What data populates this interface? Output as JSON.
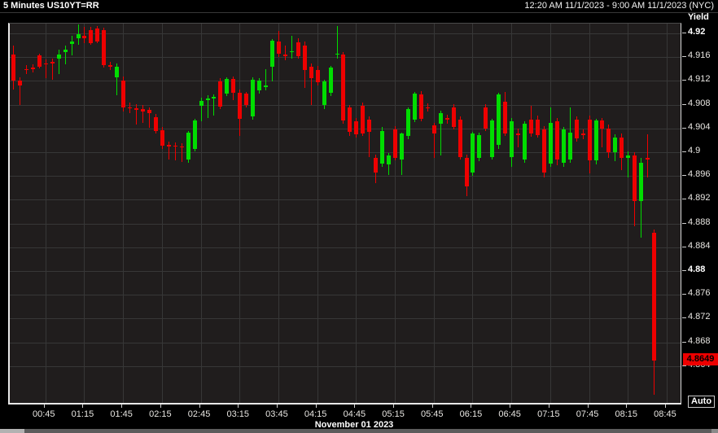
{
  "header": {
    "title": "5 Minutes US10YT=RR",
    "time_range": "12:20 AM 11/1/2023 - 9:00 AM 11/1/2023 (NYC)"
  },
  "y_axis": {
    "title": "Yield",
    "ticks": [
      {
        "label": "4.92",
        "value": 4.92,
        "bold": true
      },
      {
        "label": "4.916",
        "value": 4.916,
        "bold": false
      },
      {
        "label": "4.912",
        "value": 4.912,
        "bold": false
      },
      {
        "label": "4.908",
        "value": 4.908,
        "bold": false
      },
      {
        "label": "4.904",
        "value": 4.904,
        "bold": false
      },
      {
        "label": "4.9",
        "value": 4.9,
        "bold": false
      },
      {
        "label": "4.896",
        "value": 4.896,
        "bold": false
      },
      {
        "label": "4.892",
        "value": 4.892,
        "bold": false
      },
      {
        "label": "4.888",
        "value": 4.888,
        "bold": false
      },
      {
        "label": "4.884",
        "value": 4.884,
        "bold": false
      },
      {
        "label": "4.88",
        "value": 4.88,
        "bold": true
      },
      {
        "label": "4.876",
        "value": 4.876,
        "bold": false
      },
      {
        "label": "4.872",
        "value": 4.872,
        "bold": false
      },
      {
        "label": "4.868",
        "value": 4.868,
        "bold": false
      },
      {
        "label": "4.864",
        "value": 4.864,
        "bold": false
      }
    ],
    "last_price": "4.8649",
    "auto_button": "Auto"
  },
  "x_axis": {
    "ticks": [
      {
        "label": "00:45",
        "index": 5
      },
      {
        "label": "01:15",
        "index": 11
      },
      {
        "label": "01:45",
        "index": 17
      },
      {
        "label": "02:15",
        "index": 23
      },
      {
        "label": "02:45",
        "index": 29
      },
      {
        "label": "03:15",
        "index": 35
      },
      {
        "label": "03:45",
        "index": 41
      },
      {
        "label": "04:15",
        "index": 47
      },
      {
        "label": "04:45",
        "index": 53
      },
      {
        "label": "05:15",
        "index": 59
      },
      {
        "label": "05:45",
        "index": 65
      },
      {
        "label": "06:15",
        "index": 71
      },
      {
        "label": "06:45",
        "index": 77
      },
      {
        "label": "07:15",
        "index": 83
      },
      {
        "label": "07:45",
        "index": 89
      },
      {
        "label": "08:15",
        "index": 95
      },
      {
        "label": "08:45",
        "index": 101
      }
    ],
    "date_label": "November 01 2023"
  },
  "chart_data": {
    "type": "candlestick",
    "instrument": "US10YT=RR",
    "interval": "5 Minutes",
    "title": "5 Minutes US10YT=RR",
    "ylabel": "Yield",
    "time_range": "12:20 AM 11/1/2023 - 9:00 AM 11/1/2023 (NYC)",
    "last_price": 4.8649,
    "up_color": "#00dd00",
    "down_color": "#ee0000",
    "ylim": [
      4.857,
      4.9215
    ],
    "grid": true,
    "legend_position": "none",
    "candles": [
      [
        "00:20",
        4.9165,
        4.918,
        4.9105,
        4.912
      ],
      [
        "00:25",
        4.912,
        4.9126,
        4.908,
        4.9112
      ],
      [
        "00:30",
        4.914,
        4.9146,
        4.9132,
        4.914
      ],
      [
        "00:35",
        4.9142,
        4.9148,
        4.9134,
        4.9142
      ],
      [
        "00:40",
        4.9163,
        4.9166,
        4.9141,
        4.9144
      ],
      [
        "00:45",
        4.915,
        4.9156,
        4.9124,
        4.915
      ],
      [
        "00:50",
        4.9152,
        4.9158,
        4.9122,
        4.9152
      ],
      [
        "00:55",
        4.9158,
        4.9172,
        4.9132,
        4.9164
      ],
      [
        "01:00",
        4.9168,
        4.918,
        4.9148,
        4.9172
      ],
      [
        "01:05",
        4.9182,
        4.9196,
        4.9163,
        4.9186
      ],
      [
        "01:10",
        4.9192,
        4.9215,
        4.9181,
        4.9198
      ],
      [
        "01:15",
        4.9196,
        4.9211,
        4.9184,
        4.9192
      ],
      [
        "01:20",
        4.9206,
        4.9211,
        4.9181,
        4.9184
      ],
      [
        "01:25",
        4.9208,
        4.9213,
        4.9183,
        4.9186
      ],
      [
        "01:30",
        4.9205,
        4.9209,
        4.9142,
        4.9146
      ],
      [
        "01:35",
        4.9146,
        4.9152,
        4.9138,
        4.9145
      ],
      [
        "01:40",
        4.9126,
        4.9149,
        4.9096,
        4.9144
      ],
      [
        "01:45",
        4.9121,
        4.9127,
        4.9068,
        4.9076
      ],
      [
        "01:50",
        4.9076,
        4.9083,
        4.9066,
        4.9075
      ],
      [
        "01:55",
        4.9074,
        4.9081,
        4.9046,
        4.9071
      ],
      [
        "02:00",
        4.9073,
        4.9079,
        4.9049,
        4.9069
      ],
      [
        "02:05",
        4.9071,
        4.9076,
        4.9041,
        4.9066
      ],
      [
        "02:10",
        4.9059,
        4.9064,
        4.9031,
        4.9036
      ],
      [
        "02:15",
        4.9037,
        4.9042,
        4.9006,
        4.9011
      ],
      [
        "02:20",
        4.9012,
        4.9018,
        4.8988,
        4.901
      ],
      [
        "02:25",
        4.9011,
        4.9016,
        4.8986,
        4.9009
      ],
      [
        "02:30",
        4.901,
        4.9015,
        4.8984,
        4.9008
      ],
      [
        "02:35",
        4.8987,
        4.9036,
        4.8982,
        4.9033
      ],
      [
        "02:40",
        4.9006,
        4.9056,
        4.9002,
        4.9053
      ],
      [
        "02:45",
        4.9078,
        4.9092,
        4.9052,
        4.9086
      ],
      [
        "02:50",
        4.9088,
        4.9096,
        4.9058,
        4.909
      ],
      [
        "02:55",
        4.9091,
        4.9097,
        4.9061,
        4.9093
      ],
      [
        "03:00",
        4.9119,
        4.9124,
        4.9072,
        4.9077
      ],
      [
        "03:05",
        4.9099,
        4.9126,
        4.9094,
        4.9123
      ],
      [
        "03:10",
        4.9123,
        4.9128,
        4.9088,
        4.91
      ],
      [
        "03:15",
        4.91,
        4.9105,
        4.9028,
        4.9056
      ],
      [
        "03:20",
        4.9098,
        4.9102,
        4.9075,
        4.908
      ],
      [
        "03:25",
        4.906,
        4.9126,
        4.9055,
        4.9122
      ],
      [
        "03:30",
        4.9104,
        4.9124,
        4.9098,
        4.912
      ],
      [
        "03:35",
        4.911,
        4.914,
        4.9104,
        4.9112
      ],
      [
        "03:40",
        4.9144,
        4.919,
        4.9119,
        4.9187
      ],
      [
        "03:45",
        4.9186,
        4.9204,
        4.916,
        4.9166
      ],
      [
        "03:50",
        4.9164,
        4.918,
        4.9155,
        4.9164
      ],
      [
        "03:55",
        4.9168,
        4.9196,
        4.9158,
        4.917
      ],
      [
        "04:00",
        4.9185,
        4.9192,
        4.9158,
        4.9162
      ],
      [
        "04:05",
        4.918,
        4.9186,
        4.9108,
        4.9139
      ],
      [
        "04:10",
        4.9144,
        4.915,
        4.908,
        4.9124
      ],
      [
        "04:15",
        4.9138,
        4.9145,
        4.9112,
        4.9118
      ],
      [
        "04:20",
        4.908,
        4.9122,
        4.9072,
        4.9119
      ],
      [
        "04:25",
        4.91,
        4.9145,
        4.9094,
        4.9142
      ],
      [
        "04:30",
        4.9165,
        4.9212,
        4.9158,
        4.9166
      ],
      [
        "04:35",
        4.9164,
        4.9169,
        4.9048,
        4.9053
      ],
      [
        "04:40",
        4.9075,
        4.908,
        4.9028,
        4.9034
      ],
      [
        "04:45",
        4.9052,
        4.9058,
        4.9024,
        4.903
      ],
      [
        "04:50",
        4.9078,
        4.9083,
        4.9027,
        4.9031
      ],
      [
        "04:55",
        4.9055,
        4.906,
        4.8992,
        4.9034
      ],
      [
        "05:00",
        4.899,
        4.8996,
        4.8948,
        4.8966
      ],
      [
        "05:05",
        4.8981,
        4.9042,
        4.8975,
        4.9036
      ],
      [
        "05:10",
        4.898,
        4.8998,
        4.8962,
        4.8995
      ],
      [
        "05:15",
        4.9038,
        4.9044,
        4.8986,
        4.899
      ],
      [
        "05:20",
        4.8987,
        4.9033,
        4.8961,
        4.9031
      ],
      [
        "05:25",
        4.9028,
        4.9075,
        4.9022,
        4.9073
      ],
      [
        "05:30",
        4.9055,
        4.9101,
        4.905,
        4.9099
      ],
      [
        "05:35",
        4.9097,
        4.9103,
        4.9052,
        4.9056
      ],
      [
        "05:40",
        4.9076,
        4.9082,
        4.9068,
        4.9076
      ],
      [
        "05:45",
        4.9045,
        4.905,
        4.899,
        4.9032
      ],
      [
        "05:50",
        4.9048,
        4.907,
        4.8994,
        4.9066
      ],
      [
        "05:55",
        4.9057,
        4.9063,
        4.9048,
        4.9057
      ],
      [
        "06:00",
        4.9076,
        4.9081,
        4.9038,
        4.9042
      ],
      [
        "06:05",
        4.9055,
        4.906,
        4.8988,
        4.8992
      ],
      [
        "06:10",
        4.899,
        4.8996,
        4.8926,
        4.8942
      ],
      [
        "06:15",
        4.8966,
        4.9034,
        4.896,
        4.9031
      ],
      [
        "06:20",
        4.899,
        4.9033,
        4.8985,
        4.9029
      ],
      [
        "06:25",
        4.9076,
        4.9081,
        4.9036,
        4.904
      ],
      [
        "06:30",
        4.8992,
        4.9056,
        4.8988,
        4.9053
      ],
      [
        "06:35",
        4.9012,
        4.91,
        4.9006,
        4.9097
      ],
      [
        "06:40",
        4.9085,
        4.9102,
        4.9028,
        4.9032
      ],
      [
        "06:45",
        4.8992,
        4.9058,
        4.8975,
        4.9052
      ],
      [
        "06:50",
        4.9031,
        4.904,
        4.9008,
        4.9031
      ],
      [
        "06:55",
        4.8988,
        4.9052,
        4.8982,
        4.9048
      ],
      [
        "07:00",
        4.9055,
        4.9078,
        4.9026,
        4.9031
      ],
      [
        "07:05",
        4.9055,
        4.9061,
        4.9024,
        4.9029
      ],
      [
        "07:10",
        4.9038,
        4.9044,
        4.8958,
        4.8966
      ],
      [
        "07:15",
        4.8981,
        4.9075,
        4.8976,
        4.905
      ],
      [
        "07:20",
        4.9052,
        4.9058,
        4.8978,
        4.8988
      ],
      [
        "07:25",
        4.8982,
        4.9042,
        4.8976,
        4.9038
      ],
      [
        "07:30",
        4.8988,
        4.9075,
        4.8982,
        4.9033
      ],
      [
        "07:35",
        4.9055,
        4.906,
        4.9018,
        4.9023
      ],
      [
        "07:40",
        4.9031,
        4.9038,
        4.9022,
        4.9031
      ],
      [
        "07:45",
        4.9055,
        4.9061,
        4.8964,
        4.8986
      ],
      [
        "07:50",
        4.8986,
        4.9056,
        4.898,
        4.9053
      ],
      [
        "07:55",
        4.9053,
        4.9058,
        4.9008,
        4.904
      ],
      [
        "08:00",
        4.904,
        4.9046,
        4.899,
        4.9
      ],
      [
        "08:05",
        4.9,
        4.903,
        4.8985,
        4.9025
      ],
      [
        "08:10",
        4.9025,
        4.9032,
        4.897,
        4.899
      ],
      [
        "08:15",
        4.899,
        4.9002,
        4.8958,
        4.8995
      ],
      [
        "08:20",
        4.8995,
        4.9,
        4.8876,
        4.8918
      ],
      [
        "08:25",
        4.8918,
        4.899,
        4.8856,
        4.8982
      ],
      [
        "08:30",
        4.899,
        4.903,
        4.8958,
        4.8988
      ],
      [
        "08:35",
        4.8865,
        4.887,
        4.8592,
        4.8649
      ]
    ]
  }
}
